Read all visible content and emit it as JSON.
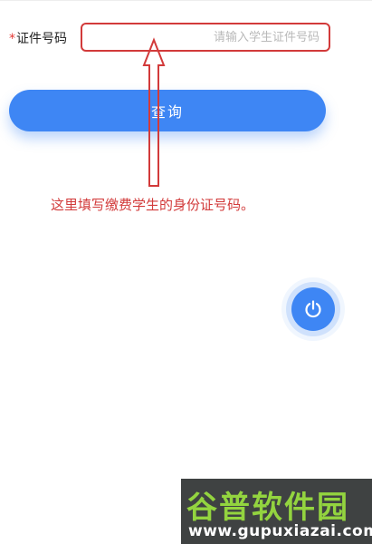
{
  "form": {
    "required_mark": "*",
    "id_label": "证件号码",
    "id_value": "",
    "id_placeholder": "请输入学生证件号码",
    "query_button": "查询"
  },
  "annotation": {
    "text": "这里填写缴费学生的身份证号码。",
    "color": "#d23a3a"
  },
  "fab": {
    "icon": "power-icon"
  },
  "watermark": {
    "title": "谷普软件园",
    "url": "www.gupuxiazai.com"
  },
  "colors": {
    "primary": "#3e86f4",
    "annotation_red": "#d23a3a",
    "watermark_green": "#8ad12f"
  }
}
